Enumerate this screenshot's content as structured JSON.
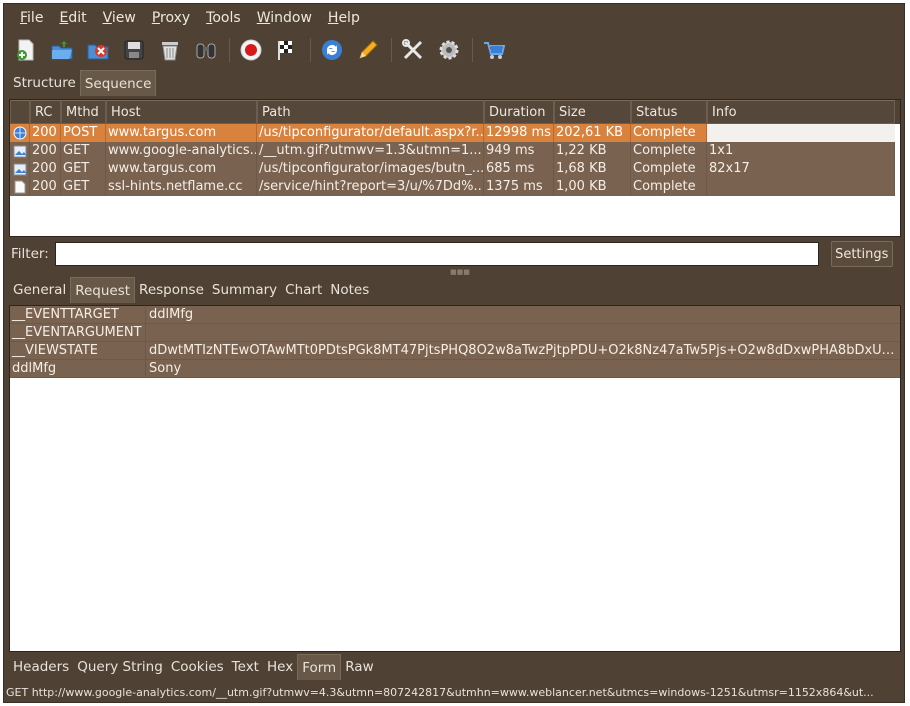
{
  "menu": [
    "File",
    "Edit",
    "View",
    "Proxy",
    "Tools",
    "Window",
    "Help"
  ],
  "menu_underline": [
    "F",
    "E",
    "V",
    "P",
    "T",
    "W",
    "H"
  ],
  "toolbar": [
    {
      "name": "new-session-icon"
    },
    {
      "name": "open-session-icon"
    },
    {
      "name": "close-session-icon"
    },
    {
      "name": "save-session-icon"
    },
    {
      "name": "clear-session-icon"
    },
    {
      "name": "find-icon"
    },
    {
      "name": "record-icon"
    },
    {
      "name": "throttling-icon"
    },
    {
      "name": "repeat-icon"
    },
    {
      "name": "edit-icon"
    },
    {
      "name": "tools-icon"
    },
    {
      "name": "settings-icon"
    },
    {
      "name": "shopping-cart-icon"
    }
  ],
  "view_tabs": [
    "Structure",
    "Sequence"
  ],
  "table": {
    "headers": [
      "RC",
      "Mthd",
      "Host",
      "Path",
      "Duration",
      "Size",
      "Status",
      "Info"
    ],
    "rows": [
      {
        "icon": "page-globe-icon",
        "rc": "200",
        "method": "POST",
        "host": "www.targus.com",
        "path": "/us/tipconfigurator/default.aspx?r...",
        "duration": "12998 ms",
        "size": "202,61 KB",
        "status": "Complete",
        "info": ""
      },
      {
        "icon": "image-icon",
        "rc": "200",
        "method": "GET",
        "host": "www.google-analytics...",
        "path": "/__utm.gif?utmwv=1.3&utmn=1...",
        "duration": "949 ms",
        "size": "1,22 KB",
        "status": "Complete",
        "info": "1x1"
      },
      {
        "icon": "image-icon",
        "rc": "200",
        "method": "GET",
        "host": "www.targus.com",
        "path": "/us/tipconfigurator/images/butn_...",
        "duration": "685 ms",
        "size": "1,68 KB",
        "status": "Complete",
        "info": "82x17"
      },
      {
        "icon": "document-icon",
        "rc": "200",
        "method": "GET",
        "host": "ssl-hints.netflame.cc",
        "path": "/service/hint?report=3/u/%7Dd%...",
        "duration": "1375 ms",
        "size": "1,00 KB",
        "status": "Complete",
        "info": ""
      }
    ]
  },
  "filter": {
    "label": "Filter:",
    "value": "",
    "settings_label": "Settings"
  },
  "detail_tabs": [
    "General",
    "Request",
    "Response",
    "Summary",
    "Chart",
    "Notes"
  ],
  "form_fields": [
    {
      "key": "__EVENTTARGET",
      "value": "ddlMfg"
    },
    {
      "key": "__EVENTARGUMENT",
      "value": ""
    },
    {
      "key": "__VIEWSTATE",
      "value": "dDwtMTIzNTEwOTAwMTt0PDtsPGk8MT47PjtsPHQ8O2w8aTwzPjtpPDU+O2k8Nz47aTw5Pjs+O2w8dDxwPHA8bDxUZX..."
    },
    {
      "key": "ddlMfg",
      "value": "Sony"
    }
  ],
  "bottom_tabs": [
    "Headers",
    "Query String",
    "Cookies",
    "Text",
    "Hex",
    "Form",
    "Raw"
  ],
  "status_bar": "GET http://www.google-analytics.com/__utm.gif?utmwv=4.3&utmn=807242817&utmhn=www.weblancer.net&utmcs=windows-1251&utmsr=1152x864&ut...",
  "colors": {
    "window_bg": "#4f4235",
    "selected_row": "#d9823e",
    "row_bg": "#7a6250",
    "active_tab": "#675847"
  }
}
